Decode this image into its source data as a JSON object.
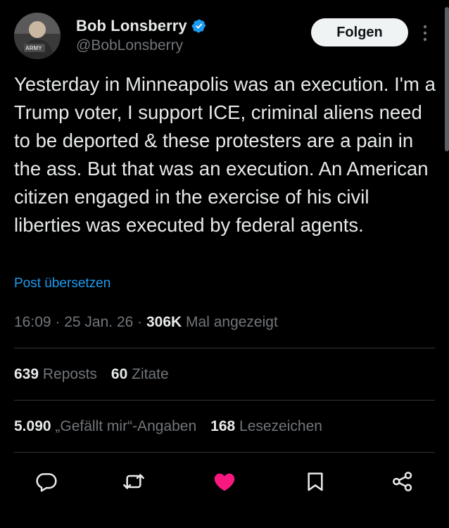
{
  "author": {
    "display_name": "Bob Lonsberry",
    "handle": "@BobLonsberry",
    "avatar_text": "ARMY"
  },
  "follow_button": {
    "label": "Folgen"
  },
  "tweet": {
    "text": "Yesterday in Minneapolis was an execution. I'm a Trump voter, I support ICE, criminal aliens need to be deported & these protesters are a pain in the ass. But that was an execution. An American citizen engaged in the exercise of his civil liberties was executed by federal agents.",
    "translate_label": "Post übersetzen"
  },
  "meta": {
    "time": "16:09",
    "sep1": " · ",
    "date": "25 Jan. 26",
    "sep2": " · ",
    "views_count": "306K",
    "views_label": " Mal angezeigt"
  },
  "stats": {
    "reposts_count": "639",
    "reposts_label": " Reposts",
    "quotes_count": "60",
    "quotes_label": " Zitate",
    "likes_count": "5.090",
    "likes_label": " „Gefällt mir“-Angaben",
    "bookmarks_count": "168",
    "bookmarks_label": " Lesezeichen"
  },
  "actions": [
    {
      "icon": "reply-icon"
    },
    {
      "icon": "repost-icon"
    },
    {
      "icon": "like-icon",
      "active": true,
      "color": "#f91880"
    },
    {
      "icon": "bookmark-icon"
    },
    {
      "icon": "share-icon"
    }
  ],
  "colors": {
    "background": "#000000",
    "text": "#e7e9ea",
    "muted": "#71767b",
    "link": "#1d9bf0",
    "verified": "#1d9bf0",
    "like_active": "#f91880",
    "divider": "#2f3336"
  }
}
